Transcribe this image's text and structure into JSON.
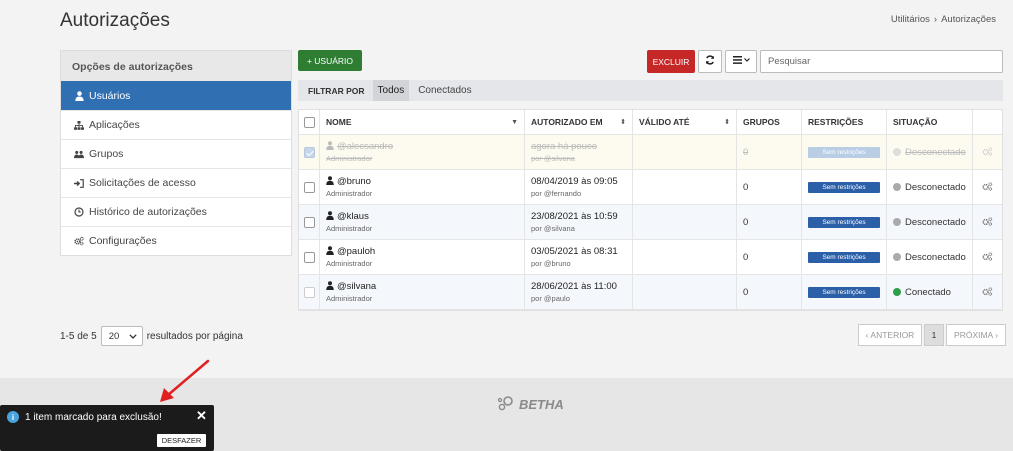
{
  "header": {
    "title": "Autorizações",
    "breadcrumb": [
      "Utilitários",
      "Autorizações"
    ],
    "breadcrumb_sep": "›"
  },
  "sidebar": {
    "title": "Opções de autorizações",
    "items": [
      {
        "label": "Usuários",
        "icon": "user-icon",
        "active": true
      },
      {
        "label": "Aplicações",
        "icon": "sitemap-icon",
        "active": false
      },
      {
        "label": "Grupos",
        "icon": "users-icon",
        "active": false
      },
      {
        "label": "Solicitações de acesso",
        "icon": "sign-in-icon",
        "active": false
      },
      {
        "label": "Histórico de autorizações",
        "icon": "history-icon",
        "active": false
      },
      {
        "label": "Configurações",
        "icon": "cogs-icon",
        "active": false
      }
    ]
  },
  "toolbar": {
    "add_label": "+ USUÁRIO",
    "delete_label": "EXCLUIR",
    "search_placeholder": "Pesquisar"
  },
  "filter": {
    "label": "FILTRAR POR",
    "options": [
      "Todos",
      "Conectados"
    ],
    "active": "Todos"
  },
  "table": {
    "columns": {
      "nome": "NOME",
      "autorizado": "AUTORIZADO EM",
      "valido": "VÁLIDO ATÉ",
      "grupos": "GRUPOS",
      "restricoes": "RESTRIÇÕES",
      "situacao": "SITUAÇÃO"
    },
    "rows": [
      {
        "user": "@alecsandro",
        "role": "Administrador",
        "authorized": "agora há pouco",
        "by": "por @silvana",
        "valid": "",
        "groups": "0",
        "restriction": "Sem restrições",
        "status": "Desconectado",
        "connected": false,
        "deleted": true,
        "checked": true
      },
      {
        "user": "@bruno",
        "role": "Administrador",
        "authorized": "08/04/2019 às 09:05",
        "by": "por @fernando",
        "valid": "",
        "groups": "0",
        "restriction": "Sem restrições",
        "status": "Desconectado",
        "connected": false,
        "deleted": false,
        "checked": false
      },
      {
        "user": "@klaus",
        "role": "Administrador",
        "authorized": "23/08/2021 às 10:59",
        "by": "por @silvana",
        "valid": "",
        "groups": "0",
        "restriction": "Sem restrições",
        "status": "Desconectado",
        "connected": false,
        "deleted": false,
        "checked": false
      },
      {
        "user": "@pauloh",
        "role": "Administrador",
        "authorized": "03/05/2021 às 08:31",
        "by": "por @bruno",
        "valid": "",
        "groups": "0",
        "restriction": "Sem restrições",
        "status": "Desconectado",
        "connected": false,
        "deleted": false,
        "checked": false
      },
      {
        "user": "@silvana",
        "role": "Administrador",
        "authorized": "28/06/2021 às 11:00",
        "by": "por @paulo",
        "valid": "",
        "groups": "0",
        "restriction": "Sem restrições",
        "status": "Conectado",
        "connected": true,
        "deleted": false,
        "checked": false
      }
    ]
  },
  "pagination": {
    "range": "1-5 de 5",
    "per_page": "20",
    "per_page_label": "resultados por página",
    "prev": "‹ ANTERIOR",
    "current": "1",
    "next": "PRÓXIMA ›"
  },
  "footer": {
    "brand": "BETHA"
  },
  "toast": {
    "message": "1 item marcado para exclusão!",
    "undo_label": "DESFAZER",
    "close": "✕"
  },
  "colors": {
    "primary": "#2f6fb2",
    "add": "#2e7d32",
    "danger": "#c62828",
    "connected": "#2e9e48",
    "annotation_arrow": "#e02020"
  }
}
